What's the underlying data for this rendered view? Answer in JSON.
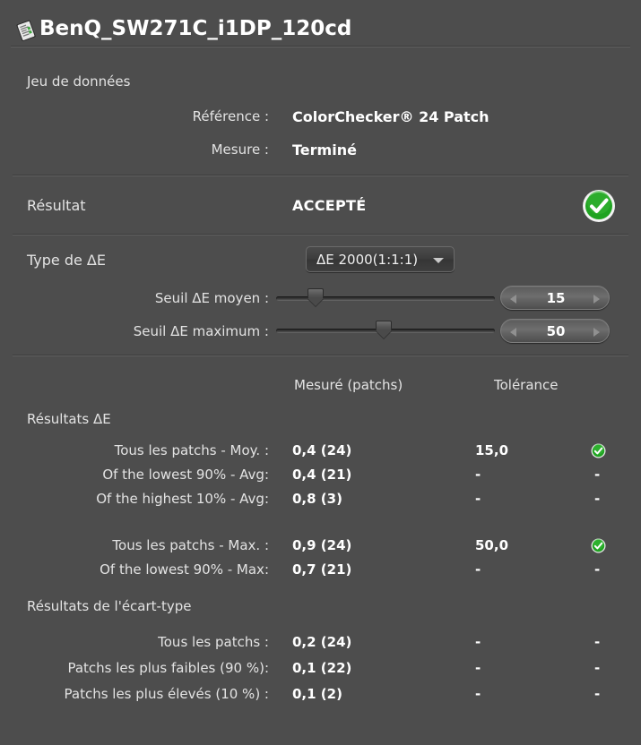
{
  "window": {
    "title": "BenQ_SW271C_i1DP_120cd",
    "title_icon": "report-document-icon"
  },
  "dataset": {
    "section_label": "Jeu de données",
    "reference_label": "Référence :",
    "reference_value": "ColorChecker® 24 Patch",
    "measure_label": "Mesure :",
    "measure_value": "Terminé"
  },
  "result": {
    "label": "Résultat",
    "verdict": "ACCEPTÉ",
    "status_icon": "green-check-circle-icon"
  },
  "delta_e": {
    "type_label": "Type de ΔE",
    "type_value": "ΔE 2000(1:1:1)",
    "dropdown_arrow_icon": "chevron-down-icon",
    "mean_threshold_label": "Seuil ΔE moyen :",
    "mean_threshold_value": "15",
    "mean_threshold_percent": 18,
    "max_threshold_label": "Seuil ΔE maximum :",
    "max_threshold_value": "50",
    "max_threshold_percent": 49
  },
  "table": {
    "columns": {
      "measured": "Mesuré (patchs)",
      "tolerance": "Tolérance"
    },
    "sections": [
      {
        "heading": "Résultats ΔE",
        "rows": [
          {
            "label": "Tous les patchs - Moy. :",
            "measured": "0,4  (24)",
            "tolerance": "15,0",
            "status": "pass"
          },
          {
            "label": "Of the lowest 90% - Avg:",
            "measured": "0,4  (21)",
            "tolerance": "-",
            "status": "-"
          },
          {
            "label": "Of the highest 10% - Avg:",
            "measured": "0,8  (3)",
            "tolerance": "-",
            "status": "-"
          },
          {
            "label": "Tous les patchs - Max. :",
            "measured": "0,9  (24)",
            "tolerance": "50,0",
            "status": "pass"
          },
          {
            "label": "Of the lowest 90% - Max:",
            "measured": "0,7  (21)",
            "tolerance": "-",
            "status": "-"
          }
        ]
      },
      {
        "heading": "Résultats de l'écart-type",
        "rows": [
          {
            "label": "Tous les patchs :",
            "measured": "0,2  (24)",
            "tolerance": "-",
            "status": "-"
          },
          {
            "label": "Patchs les plus faibles (90 %):",
            "measured": "0,1  (22)",
            "tolerance": "-",
            "status": "-"
          },
          {
            "label": "Patchs les plus élevés (10 %) :",
            "measured": "0,1  (2)",
            "tolerance": "-",
            "status": "-"
          }
        ]
      }
    ]
  },
  "colors": {
    "background": "#4d4d4d",
    "text": "#e3e3e3",
    "value_text": "#ffffff",
    "pass_green": "#1fa321",
    "separator_dark": "#3d3d3d",
    "separator_light": "#606060"
  }
}
